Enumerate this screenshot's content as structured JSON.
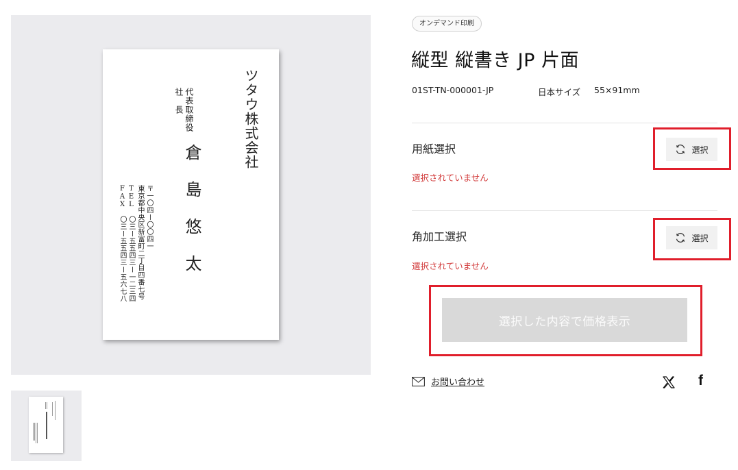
{
  "preview": {
    "card": {
      "company": "ツタウ株式会社",
      "title_line1": "代表取締役",
      "title_line2": "社　長",
      "name": "倉島悠太",
      "address_line1": "〒一〇四ー〇〇四一",
      "address_line2": "東京都中央区新富町二丁目四番七号",
      "address_line3": "TEL　〇三ー五五四三ー一二三四",
      "address_line4": "FAX　〇三ー五五四三ー五六七八"
    }
  },
  "product": {
    "badge": "オンデマンド印刷",
    "title": "縦型 縦書き JP 片面",
    "code": "01ST-TN-000001-JP",
    "size_label": "日本サイズ",
    "size_value": "55×91mm"
  },
  "options": [
    {
      "label": "用紙選択",
      "status": "選択されていません",
      "button": "選択"
    },
    {
      "label": "角加工選択",
      "status": "選択されていません",
      "button": "選択"
    }
  ],
  "price_button": "選択した内容で価格表示",
  "contact_label": "お問い合わせ",
  "icons": {
    "mail": "mail-icon",
    "refresh": "refresh-icon",
    "x": "x-icon",
    "facebook": "facebook-icon"
  },
  "colors": {
    "highlight": "#e01e2b",
    "status_red": "#d23c3c",
    "disabled_button": "#d9d9d9"
  }
}
